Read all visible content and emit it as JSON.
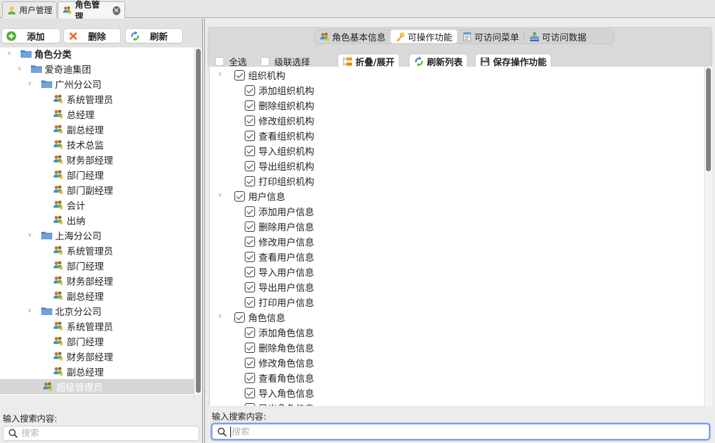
{
  "window_tabs": [
    {
      "label": "用户管理",
      "icon": "user-icon",
      "active": false
    },
    {
      "label": "角色管理",
      "icon": "role-icon",
      "active": true,
      "closable": true
    }
  ],
  "left": {
    "toolbar": {
      "add_label": "添加",
      "delete_label": "删除",
      "refresh_label": "刷新"
    },
    "tree": [
      {
        "label": "角色分类",
        "type": "folder",
        "level": 0,
        "expanded": true
      },
      {
        "label": "爱奇迪集团",
        "type": "folder",
        "level": 1,
        "expanded": true
      },
      {
        "label": "广州分公司",
        "type": "folder",
        "level": 2,
        "expanded": true
      },
      {
        "label": "系统管理员",
        "type": "role",
        "level": 3
      },
      {
        "label": "总经理",
        "type": "role",
        "level": 3
      },
      {
        "label": "副总经理",
        "type": "role",
        "level": 3
      },
      {
        "label": "技术总监",
        "type": "role",
        "level": 3
      },
      {
        "label": "财务部经理",
        "type": "role",
        "level": 3
      },
      {
        "label": "部门经理",
        "type": "role",
        "level": 3
      },
      {
        "label": "部门副经理",
        "type": "role",
        "level": 3
      },
      {
        "label": "会计",
        "type": "role",
        "level": 3
      },
      {
        "label": "出纳",
        "type": "role",
        "level": 3
      },
      {
        "label": "上海分公司",
        "type": "folder",
        "level": 2,
        "expanded": true
      },
      {
        "label": "系统管理员",
        "type": "role",
        "level": 3
      },
      {
        "label": "部门经理",
        "type": "role",
        "level": 3
      },
      {
        "label": "财务部经理",
        "type": "role",
        "level": 3
      },
      {
        "label": "副总经理",
        "type": "role",
        "level": 3
      },
      {
        "label": "北京分公司",
        "type": "folder",
        "level": 2,
        "expanded": true
      },
      {
        "label": "系统管理员",
        "type": "role",
        "level": 3
      },
      {
        "label": "部门经理",
        "type": "role",
        "level": 3
      },
      {
        "label": "财务部经理",
        "type": "role",
        "level": 3
      },
      {
        "label": "副总经理",
        "type": "role",
        "level": 3
      },
      {
        "label": "超级管理员",
        "type": "role",
        "level": 2,
        "selected": true
      }
    ],
    "search": {
      "label": "输入搜索内容:",
      "placeholder": "搜索",
      "value": ""
    }
  },
  "right": {
    "tabs": [
      {
        "label": "角色基本信息",
        "icon": "role-icon",
        "active": false
      },
      {
        "label": "可操作功能",
        "icon": "key-icon",
        "active": true
      },
      {
        "label": "可访问菜单",
        "icon": "menu-doc-icon",
        "active": false
      },
      {
        "label": "可访问数据",
        "icon": "data-network-icon",
        "active": false
      }
    ],
    "options": {
      "select_all_label": "全选",
      "select_all_checked": false,
      "cascade_label": "级联选择",
      "cascade_checked": false
    },
    "buttons": {
      "collapse_expand_label": "折叠/展开",
      "refresh_list_label": "刷新列表",
      "save_label": "保存操作功能"
    },
    "permissions": [
      {
        "label": "组织机构",
        "checked": true,
        "children": [
          {
            "label": "添加组织机构",
            "checked": true
          },
          {
            "label": "删除组织机构",
            "checked": true
          },
          {
            "label": "修改组织机构",
            "checked": true
          },
          {
            "label": "查看组织机构",
            "checked": true
          },
          {
            "label": "导入组织机构",
            "checked": true
          },
          {
            "label": "导出组织机构",
            "checked": true
          },
          {
            "label": "打印组织机构",
            "checked": true
          }
        ]
      },
      {
        "label": "用户信息",
        "checked": true,
        "children": [
          {
            "label": "添加用户信息",
            "checked": true
          },
          {
            "label": "删除用户信息",
            "checked": true
          },
          {
            "label": "修改用户信息",
            "checked": true
          },
          {
            "label": "查看用户信息",
            "checked": true
          },
          {
            "label": "导入用户信息",
            "checked": true
          },
          {
            "label": "导出用户信息",
            "checked": true
          },
          {
            "label": "打印用户信息",
            "checked": true
          }
        ]
      },
      {
        "label": "角色信息",
        "checked": true,
        "children": [
          {
            "label": "添加角色信息",
            "checked": true
          },
          {
            "label": "删除角色信息",
            "checked": true
          },
          {
            "label": "修改角色信息",
            "checked": true
          },
          {
            "label": "查看角色信息",
            "checked": true
          },
          {
            "label": "导入角色信息",
            "checked": true
          },
          {
            "label": "导出角色信息",
            "checked": true
          }
        ]
      }
    ],
    "search": {
      "label": "输入搜索内容:",
      "placeholder": "搜索",
      "value": ""
    }
  }
}
